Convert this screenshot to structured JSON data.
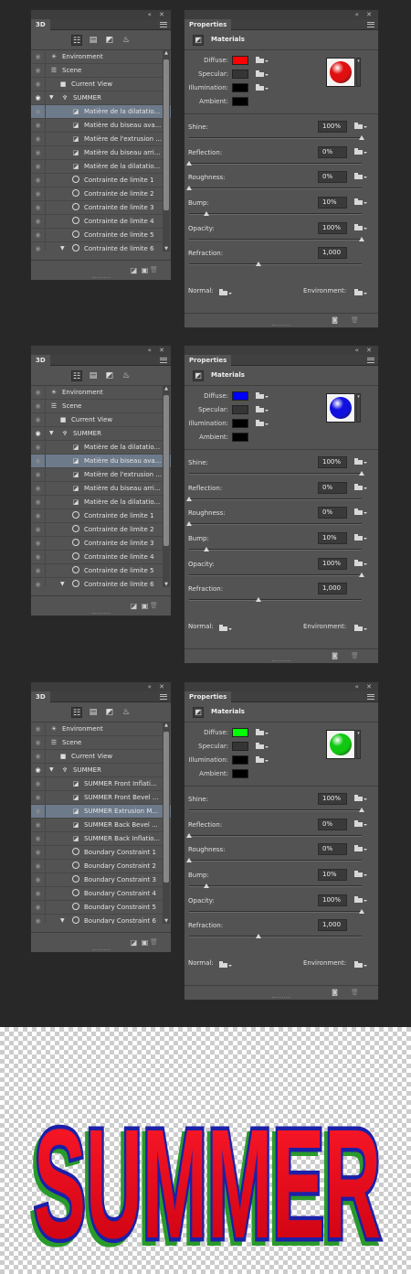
{
  "window_controls": "«  ✕",
  "panel3d_tab": "3D",
  "properties_tab": "Properties",
  "materials_title": "Materials",
  "color_labels": {
    "diffuse": "Diffuse:",
    "specular": "Specular:",
    "illumination": "Illumination:",
    "ambient": "Ambient:"
  },
  "slider_labels": {
    "shine": "Shine:",
    "reflection": "Reflection:",
    "roughness": "Roughness:",
    "bump": "Bump:",
    "opacity": "Opacity:",
    "refraction": "Refraction:"
  },
  "slider_values": {
    "shine": "100%",
    "reflection": "0%",
    "roughness": "0%",
    "bump": "10%",
    "opacity": "100%",
    "refraction": "1,000"
  },
  "slider_levels": {
    "shine": 1.0,
    "reflection": 0.0,
    "roughness": 0.0,
    "bump": 0.1,
    "opacity": 1.0,
    "refraction": 0.4
  },
  "normal_label": "Normal:",
  "environment_label": "Environment:",
  "icons": {
    "eye": "eye-icon",
    "folder": "folder-icon",
    "scene": "scene-icon",
    "camera": "camera-icon",
    "light": "light-icon",
    "constraint": "constraint-circle-icon",
    "material": "material-icon"
  },
  "panels": [
    {
      "diffuse_color": "#ff0000",
      "sphere_color": "#e01010",
      "layers": [
        {
          "label": "Environment",
          "type": "env",
          "eye": false,
          "sel": false
        },
        {
          "label": "Scene",
          "type": "scene",
          "eye": false,
          "sel": false
        },
        {
          "label": "Current View",
          "type": "camera",
          "eye": false,
          "sel": false
        },
        {
          "label": "SUMMER",
          "type": "mesh",
          "eye": true,
          "sel": false
        },
        {
          "label": "Matière de la dilatatio...",
          "type": "mat",
          "eye": false,
          "sel": true
        },
        {
          "label": "Matière du biseau ava...",
          "type": "mat",
          "eye": false,
          "sel": false
        },
        {
          "label": "Matière de l'extrusion ...",
          "type": "mat",
          "eye": false,
          "sel": false
        },
        {
          "label": "Matière du biseau arri...",
          "type": "mat",
          "eye": false,
          "sel": false
        },
        {
          "label": "Matière de la dilatatio...",
          "type": "mat",
          "eye": false,
          "sel": false
        },
        {
          "label": "Contrainte de limite 1",
          "type": "constraint",
          "eye": false,
          "sel": false
        },
        {
          "label": "Contrainte de limite 2",
          "type": "constraint",
          "eye": false,
          "sel": false
        },
        {
          "label": "Contrainte de limite 3",
          "type": "constraint",
          "eye": false,
          "sel": false
        },
        {
          "label": "Contrainte de limite 4",
          "type": "constraint",
          "eye": false,
          "sel": false
        },
        {
          "label": "Contrainte de limite 5",
          "type": "constraint",
          "eye": false,
          "sel": false
        },
        {
          "label": "Contrainte de limite 6",
          "type": "constraint6",
          "eye": false,
          "sel": false
        }
      ]
    },
    {
      "diffuse_color": "#0000ff",
      "sphere_color": "#1010e0",
      "layers": [
        {
          "label": "Environment",
          "type": "env",
          "eye": false,
          "sel": false
        },
        {
          "label": "Scene",
          "type": "scene",
          "eye": false,
          "sel": false
        },
        {
          "label": "Current View",
          "type": "camera",
          "eye": false,
          "sel": false
        },
        {
          "label": "SUMMER",
          "type": "mesh",
          "eye": true,
          "sel": false
        },
        {
          "label": "Matière de la dilatatio...",
          "type": "mat",
          "eye": false,
          "sel": false
        },
        {
          "label": "Matière du biseau ava...",
          "type": "mat",
          "eye": false,
          "sel": true
        },
        {
          "label": "Matière de l'extrusion ...",
          "type": "mat",
          "eye": false,
          "sel": false
        },
        {
          "label": "Matière du biseau arri...",
          "type": "mat",
          "eye": false,
          "sel": false
        },
        {
          "label": "Matière de la dilatatio...",
          "type": "mat",
          "eye": false,
          "sel": false
        },
        {
          "label": "Contrainte de limite 1",
          "type": "constraint",
          "eye": false,
          "sel": false
        },
        {
          "label": "Contrainte de limite 2",
          "type": "constraint",
          "eye": false,
          "sel": false
        },
        {
          "label": "Contrainte de limite 3",
          "type": "constraint",
          "eye": false,
          "sel": false
        },
        {
          "label": "Contrainte de limite 4",
          "type": "constraint",
          "eye": false,
          "sel": false
        },
        {
          "label": "Contrainte de limite 5",
          "type": "constraint",
          "eye": false,
          "sel": false
        },
        {
          "label": "Contrainte de limite 6",
          "type": "constraint6",
          "eye": false,
          "sel": false
        }
      ]
    },
    {
      "diffuse_color": "#00ff00",
      "sphere_color": "#10c810",
      "layers": [
        {
          "label": "Environment",
          "type": "env",
          "eye": false,
          "sel": false
        },
        {
          "label": "Scene",
          "type": "scene",
          "eye": false,
          "sel": false
        },
        {
          "label": "Current View",
          "type": "camera",
          "eye": false,
          "sel": false
        },
        {
          "label": "SUMMER",
          "type": "mesh",
          "eye": true,
          "sel": false
        },
        {
          "label": "SUMMER Front Inflati...",
          "type": "mat",
          "eye": false,
          "sel": false
        },
        {
          "label": "SUMMER Front Bevel ...",
          "type": "mat",
          "eye": false,
          "sel": false
        },
        {
          "label": "SUMMER Extrusion M...",
          "type": "mat",
          "eye": false,
          "sel": true
        },
        {
          "label": "SUMMER Back Bevel ...",
          "type": "mat",
          "eye": false,
          "sel": false
        },
        {
          "label": "SUMMER Back Inflatio...",
          "type": "mat",
          "eye": false,
          "sel": false
        },
        {
          "label": "Boundary Constraint 1",
          "type": "constraint",
          "eye": false,
          "sel": false
        },
        {
          "label": "Boundary Constraint 2",
          "type": "constraint",
          "eye": false,
          "sel": false
        },
        {
          "label": "Boundary Constraint 3",
          "type": "constraint",
          "eye": false,
          "sel": false
        },
        {
          "label": "Boundary Constraint 4",
          "type": "constraint",
          "eye": false,
          "sel": false
        },
        {
          "label": "Boundary Constraint 5",
          "type": "constraint",
          "eye": false,
          "sel": false
        },
        {
          "label": "Boundary Constraint 6",
          "type": "constraint6",
          "eye": false,
          "sel": false
        }
      ]
    }
  ],
  "artwork": {
    "text": "SUMMER",
    "fill_color": "#e0001a",
    "outline_color": "#1c20a8",
    "extrusion_color": "#2a9a2a"
  }
}
